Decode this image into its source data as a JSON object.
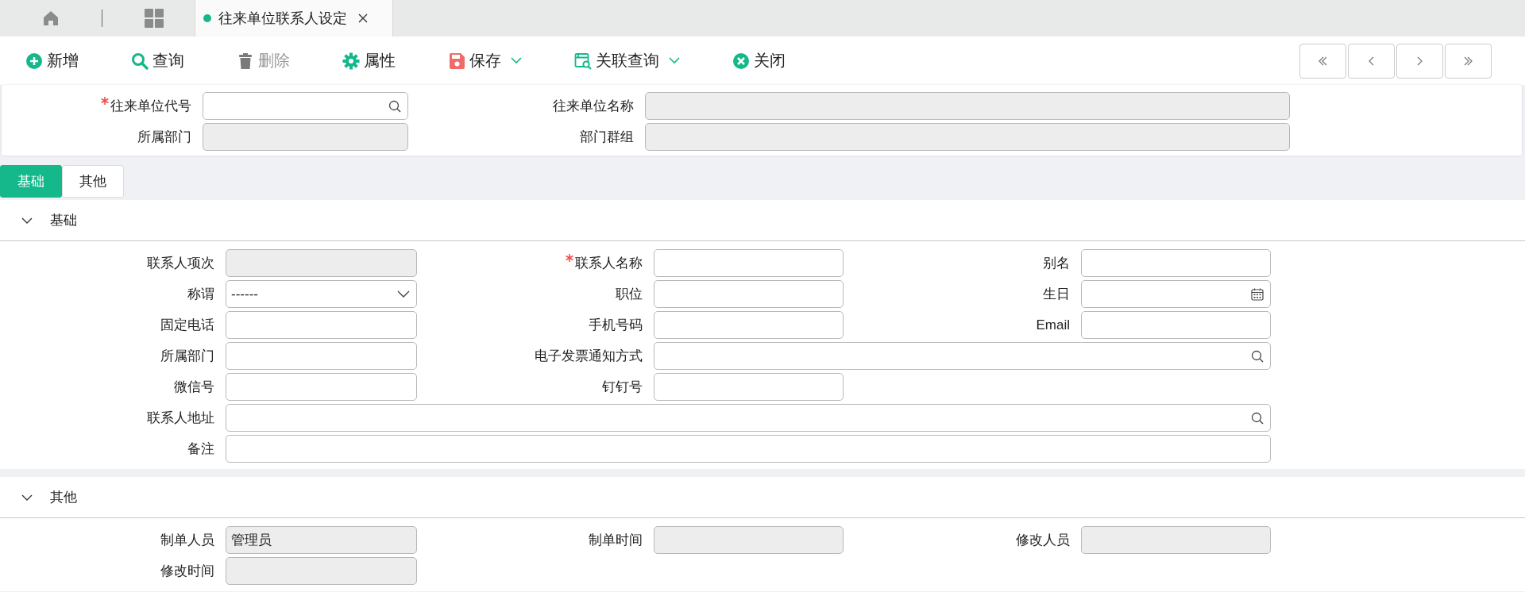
{
  "tab_bar": {
    "tabs": [
      {
        "title": "往来单位联系人设定",
        "selected": true
      }
    ]
  },
  "toolbar": {
    "buttons": [
      {
        "label": "新增",
        "kind": "add",
        "disabled": false,
        "dropdown": false
      },
      {
        "label": "查询",
        "kind": "search",
        "disabled": false,
        "dropdown": false
      },
      {
        "label": "删除",
        "kind": "delete",
        "disabled": true,
        "dropdown": false
      },
      {
        "label": "属性",
        "kind": "properties",
        "disabled": false,
        "dropdown": false
      },
      {
        "label": "保存",
        "kind": "save",
        "disabled": false,
        "dropdown": true
      },
      {
        "label": "关联查询",
        "kind": "linked",
        "disabled": false,
        "dropdown": true
      },
      {
        "label": "关闭",
        "kind": "close",
        "disabled": false,
        "dropdown": false
      }
    ]
  },
  "header": {
    "rows": [
      [
        {
          "label": "往来单位代号",
          "required": true,
          "kind": "search",
          "readonly": false
        },
        {
          "label": "往来单位名称",
          "required": false,
          "kind": "text",
          "readonly": true
        }
      ],
      [
        {
          "label": "所属部门",
          "required": false,
          "kind": "text",
          "readonly": true
        },
        {
          "label": "部门群组",
          "required": false,
          "kind": "text",
          "readonly": true
        }
      ]
    ]
  },
  "tabs": [
    {
      "label": "基础",
      "selected": true
    },
    {
      "label": "其他",
      "selected": false
    }
  ],
  "sections": [
    {
      "title": "基础",
      "expanded": true,
      "rows": [
        [
          {
            "label": "联系人项次",
            "required": false,
            "kind": "text",
            "readonly": true
          },
          {
            "label": "联系人名称",
            "required": true,
            "kind": "text",
            "readonly": false
          },
          {
            "label": "别名",
            "required": false,
            "kind": "text",
            "readonly": false
          }
        ],
        [
          {
            "label": "称谓",
            "required": false,
            "kind": "select",
            "readonly": false,
            "value": "------"
          },
          {
            "label": "职位",
            "required": false,
            "kind": "text",
            "readonly": false
          },
          {
            "label": "生日",
            "required": false,
            "kind": "date",
            "readonly": false
          }
        ],
        [
          {
            "label": "固定电话",
            "required": false,
            "kind": "text",
            "readonly": false
          },
          {
            "label": "手机号码",
            "required": false,
            "kind": "text",
            "readonly": false
          },
          {
            "label": "Email",
            "required": false,
            "kind": "text",
            "readonly": false
          }
        ],
        [
          {
            "label": "所属部门",
            "required": false,
            "kind": "text",
            "readonly": false
          },
          {
            "label": "电子发票通知方式",
            "required": false,
            "kind": "search",
            "readonly": false,
            "wide": true
          }
        ],
        [
          {
            "label": "微信号",
            "required": false,
            "kind": "text",
            "readonly": false
          },
          {
            "label": "钉钉号",
            "required": false,
            "kind": "text",
            "readonly": false
          }
        ],
        [
          {
            "label": "联系人地址",
            "required": false,
            "kind": "search",
            "readonly": false,
            "wide": true
          }
        ],
        [
          {
            "label": "备注",
            "required": false,
            "kind": "text",
            "readonly": false,
            "wide": true
          }
        ]
      ]
    },
    {
      "title": "其他",
      "expanded": true,
      "rows": [
        [
          {
            "label": "制单人员",
            "required": false,
            "kind": "text",
            "readonly": true,
            "value": "管理员"
          },
          {
            "label": "制单时间",
            "required": false,
            "kind": "text",
            "readonly": true
          },
          {
            "label": "修改人员",
            "required": false,
            "kind": "text",
            "readonly": true
          }
        ],
        [
          {
            "label": "修改时间",
            "required": false,
            "kind": "text",
            "readonly": true
          }
        ]
      ]
    }
  ]
}
